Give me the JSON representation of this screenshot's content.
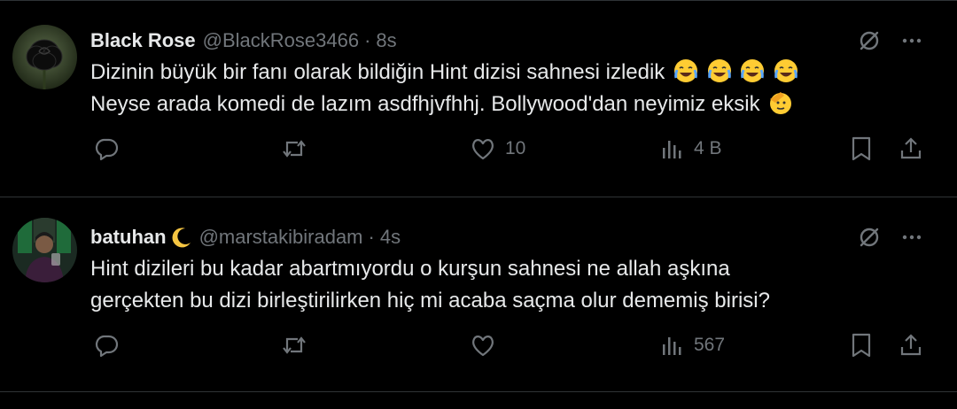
{
  "tweets": [
    {
      "name": "Black Rose",
      "handle": "@BlackRose3466",
      "time": "8s",
      "line1": "Dizinin büyük bir fanı olarak bildiğin Hint dizisi sahnesi izledik",
      "line2": "Neyse arada komedi de lazım asdfhjvfhhj. Bollywood'dan neyimiz eksik",
      "likes": "10",
      "views": "4 B",
      "icons": [
        "grok-icon",
        "more-icon",
        "reply-icon",
        "retweet-icon",
        "like-icon",
        "views-icon",
        "bookmark-icon",
        "share-icon"
      ]
    },
    {
      "name": "batuhan",
      "handle": "@marstakibiradam",
      "time": "4s",
      "line1": "Hint dizileri bu kadar abartmıyordu o kurşun sahnesi ne allah aşkına",
      "line2": "gerçekten bu dizi birleştirilirken hiç mi acaba saçma olur dememiş birisi?",
      "likes": "",
      "views": "567"
    }
  ],
  "separator": "·",
  "colors": {
    "background": "#000000",
    "text": "#e7e9ea",
    "muted": "#71767b",
    "border": "#2f3336"
  }
}
